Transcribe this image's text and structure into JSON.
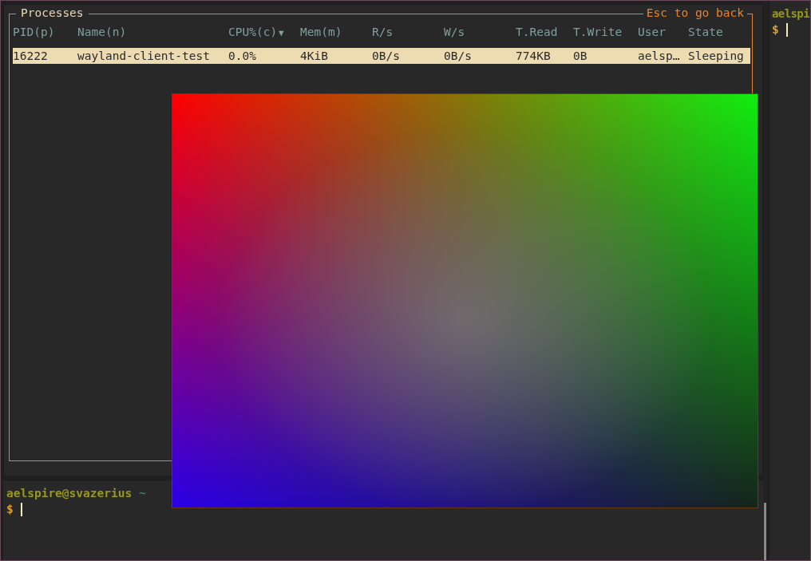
{
  "process_panel": {
    "title": "Processes",
    "hint": "Esc to go back",
    "columns": [
      {
        "label": "PID(p)"
      },
      {
        "label": "Name(n)"
      },
      {
        "label": "CPU%(c)",
        "sort_indicator": "▼"
      },
      {
        "label": "Mem(m)"
      },
      {
        "label": "R/s"
      },
      {
        "label": "W/s"
      },
      {
        "label": "T.Read"
      },
      {
        "label": "T.Write"
      },
      {
        "label": "User"
      },
      {
        "label": "State"
      }
    ],
    "rows": [
      {
        "selected": true,
        "cells": [
          "16222",
          "wayland-client-test",
          "0.0%",
          "4KiB",
          "0B/s",
          "0B/s",
          "774KB",
          "0B",
          "aelsp…",
          "Sleeping"
        ]
      }
    ]
  },
  "bottom_terminal": {
    "user_host": "aelspire@svazerius",
    "cwd": "~",
    "prompt": "$"
  },
  "right_terminal": {
    "user_host": "aelspi",
    "prompt": "$"
  },
  "floating_window": {
    "kind": "gradient"
  }
}
